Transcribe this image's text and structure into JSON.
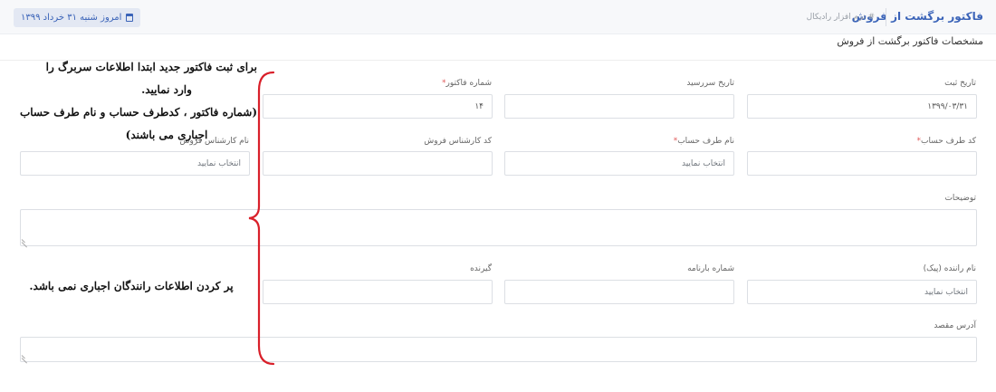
{
  "header": {
    "title": "فاکتور برگشت از فروش",
    "breadcrumb": "# نرم افزار رادیکال",
    "date_label": "امروز شنبه ۳۱ خرداد ۱۳۹۹"
  },
  "section_title": "مشخصات فاکتور برگشت از فروش",
  "fields": {
    "reg_date": {
      "label": "تاریخ ثبت",
      "value": "۱۳۹۹/۰۳/۳۱"
    },
    "due_date": {
      "label": "تاریخ سررسید",
      "value": ""
    },
    "invoice_no": {
      "label": "شماره فاکتور",
      "value": "۱۴"
    },
    "account_code": {
      "label": "کد طرف حساب",
      "value": ""
    },
    "account_name": {
      "label": "نام طرف حساب",
      "placeholder": "انتخاب نمایید"
    },
    "sales_expert_code": {
      "label": "کد کارشناس فروش",
      "value": ""
    },
    "sales_expert_name": {
      "label": "نام کارشناس فروش",
      "placeholder": "انتخاب نمایید"
    },
    "description": {
      "label": "توضیحات"
    },
    "driver_name": {
      "label": "نام راننده (پیک)",
      "placeholder": "انتخاب نمایید"
    },
    "waybill_no": {
      "label": "شماره بارنامه",
      "value": ""
    },
    "receiver": {
      "label": "گیرنده",
      "value": ""
    },
    "destination": {
      "label": "آدرس مقصد"
    }
  },
  "required_mark": "*",
  "annotations": {
    "note1_line1": "برای ثبت فاکتور جدید ابتدا اطلاعات سربرگ را",
    "note1_line2": "وارد نمایید.",
    "note1_line3": "(شماره فاکتور ، کدطرف حساب و نام طرف حساب",
    "note1_line4": "اجباری می باشند)",
    "note2": "پر کردن اطلاعات رانندگان اجباری نمی باشد.",
    "brace_color": "#d9202a"
  },
  "colors": {
    "accent": "#3a63b8",
    "required": "#e05a5a"
  }
}
